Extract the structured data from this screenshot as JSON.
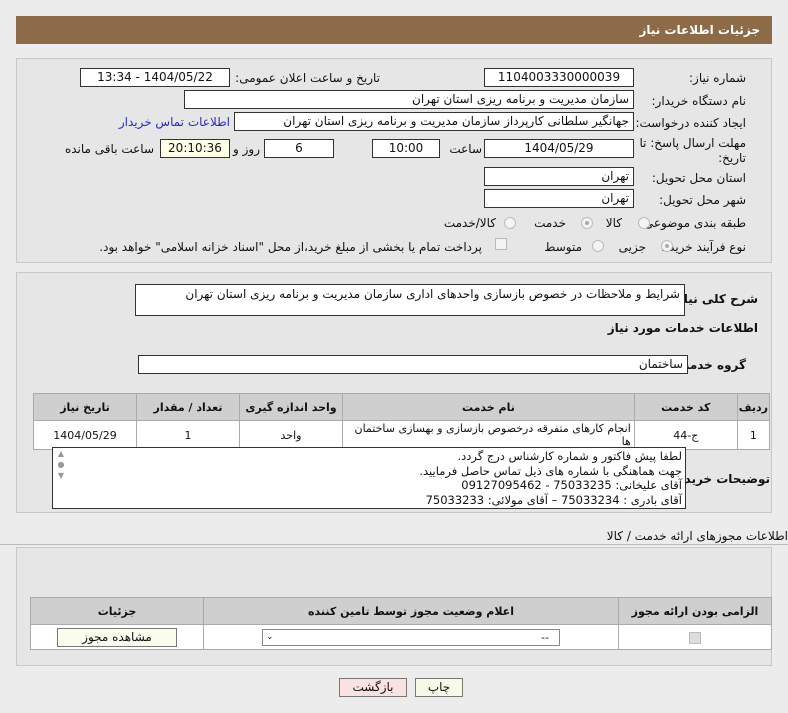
{
  "header": {
    "title": "جزئیات اطلاعات نیاز"
  },
  "need_number": {
    "label": "شماره نیاز:",
    "value": "1104003330000039"
  },
  "announce": {
    "label": "تاریخ و ساعت اعلان عمومی:",
    "value": "1404/05/22 - 13:34"
  },
  "buyer_org": {
    "label": "نام دستگاه خریدار:",
    "value": "سازمان مدیریت و برنامه ریزی استان تهران"
  },
  "creator": {
    "label": "ایجاد کننده درخواست:",
    "value": "جهانگیر سلطانی کارپرداز سازمان مدیریت و برنامه ریزی استان تهران",
    "contact_link": "اطلاعات تماس خریدار"
  },
  "deadline": {
    "label": "مهلت ارسال پاسخ: تا تاریخ:",
    "date": "1404/05/29",
    "time_label": "ساعت",
    "time": "10:00",
    "days": "6",
    "days_label": "روز و",
    "remaining": "20:10:36",
    "remaining_label": "ساعت باقی مانده"
  },
  "province": {
    "label": "استان محل تحویل:",
    "value": "تهران"
  },
  "city": {
    "label": "شهر محل تحویل:",
    "value": "تهران"
  },
  "category": {
    "label": "طبقه بندی موضوعی:",
    "options": [
      "کالا",
      "خدمت",
      "کالا/خدمت"
    ],
    "selected": "خدمت"
  },
  "process": {
    "label": "نوع فرآیند خرید :",
    "options": [
      "جزیی",
      "متوسط"
    ],
    "selected": "جزیی",
    "payment_note": "پرداخت تمام یا بخشی از مبلغ خرید،از محل \"اسناد خزانه اسلامی\" خواهد بود."
  },
  "summary": {
    "label": "شرح کلی نیاز:",
    "value": "شرایط و ملاحظات در خصوص بازسازی واحدهای اداری سازمان مدیریت و برنامه ریزی استان تهران"
  },
  "services_title": "اطلاعات خدمات مورد نیاز",
  "service_group": {
    "label": "گروه خدمت:",
    "value": "ساختمان"
  },
  "table": {
    "headers": [
      "ردیف",
      "کد خدمت",
      "نام خدمت",
      "واحد اندازه گیری",
      "تعداد / مقدار",
      "تاریخ نیاز"
    ],
    "rows": [
      [
        "1",
        "ج-44",
        "انجام کارهای متفرقه درخصوص بازسازی و بهسازی ساختمان ها",
        "واحد",
        "1",
        "1404/05/29"
      ]
    ]
  },
  "buyer_notes": {
    "label": "توضیحات خریدار:",
    "lines": [
      "لطفا پیش فاکتور و شماره کارشناس درج گردد.",
      "جهت هماهنگی با شماره های ذیل تماس حاصل فرمایید.",
      "آقای علیخانی: 75033235 - 09127095462",
      "آقای بادری : 75033234 – آقای مولائی: 75033233"
    ]
  },
  "permits": {
    "title": "اطلاعات مجوزهای ارائه خدمت / کالا",
    "headers": [
      "الزامی بودن ارائه مجوز",
      "اعلام وضعیت مجوز توسط تامین کننده",
      "جزئیات"
    ],
    "select_value": "--",
    "view_button": "مشاهده مجوز"
  },
  "buttons": {
    "print": "چاپ",
    "back": "بازگشت"
  }
}
